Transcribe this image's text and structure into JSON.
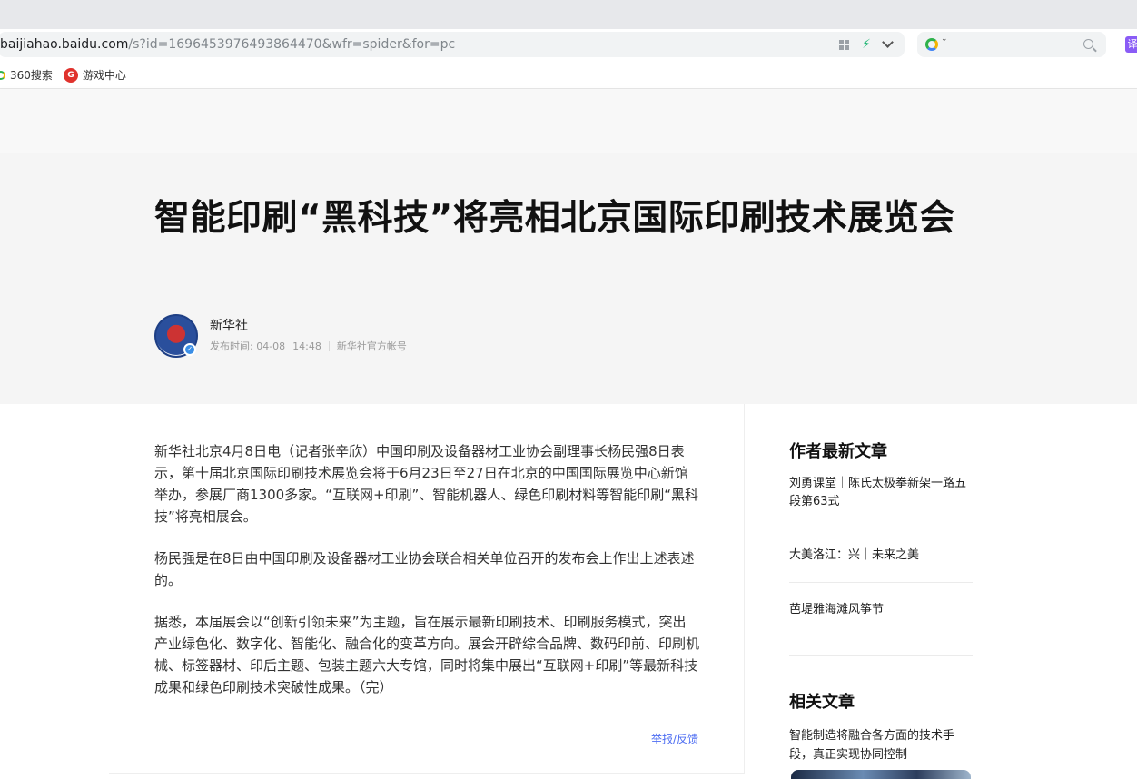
{
  "browser": {
    "url_host": "baijiahao.baidu.com",
    "url_path": "/s?id=1696453976493864470&wfr=spider&for=pc",
    "translate_label": "译",
    "bookmarks": [
      {
        "label": "360搜索",
        "icon": "360-search-icon"
      },
      {
        "label": "游戏中心",
        "icon": "game-center-icon"
      }
    ]
  },
  "article": {
    "title": "智能印刷“黑科技”将亮相北京国际印刷技术展览会",
    "author": "新华社",
    "publish_label": "发布时间: 04-08",
    "publish_time": "14:48",
    "account_label": "新华社官方帐号",
    "paragraphs": [
      "新华社北京4月8日电（记者张辛欣）中国印刷及设备器材工业协会副理事长杨民强8日表示，第十届北京国际印刷技术展览会将于6月23日至27日在北京的中国国际展览中心新馆举办，参展厂商1300多家。“互联网+印刷”、智能机器人、绿色印刷材料等智能印刷“黑科技”将亮相展会。",
      "杨民强是在8日由中国印刷及设备器材工业协会联合相关单位召开的发布会上作出上述表述的。",
      "据悉，本届展会以“创新引领未来”为主题，旨在展示最新印刷技术、印刷服务模式，突出产业绿色化、数字化、智能化、融合化的变革方向。展会开辟综合品牌、数码印前、印刷机械、标签器材、印后主题、包装主题六大专馆，同时将集中展出“互联网+印刷”等最新科技成果和绿色印刷技术突破性成果。（完）"
    ],
    "report_label": "举报/反馈"
  },
  "sidebar": {
    "latest_title": "作者最新文章",
    "latest_items": [
      "刘勇课堂｜陈氏太极拳新架一路五段第63式",
      "大美洛江：兴｜未来之美",
      "芭堤雅海滩风筝节"
    ],
    "related_title": "相关文章",
    "related_items": [
      "智能制造将融合各方面的技术手段，真正实现协同控制"
    ]
  },
  "colors": {
    "accent_link": "#4e6ef2",
    "verify_badge": "#3a8ee6",
    "hero_bg": "#f5f5f5"
  }
}
